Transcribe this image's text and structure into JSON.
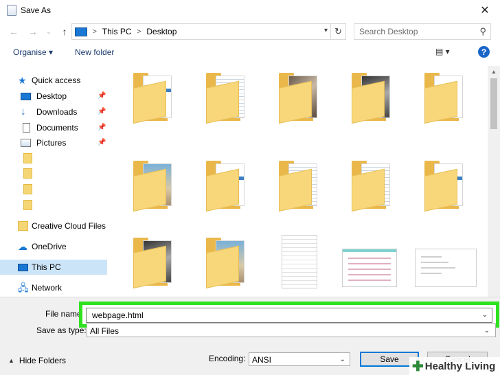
{
  "window": {
    "title": "Save As",
    "close_glyph": "✕"
  },
  "address": {
    "crumbs": [
      "This PC",
      "Desktop"
    ],
    "separator": ">",
    "search_placeholder": "Search Desktop"
  },
  "toolbar": {
    "organise": "Organise ▾",
    "new_folder": "New folder",
    "help": "?"
  },
  "sidebar": {
    "quick_access": "Quick access",
    "desktop": "Desktop",
    "downloads": "Downloads",
    "documents": "Documents",
    "pictures": "Pictures",
    "creative_cloud": "Creative Cloud Files",
    "onedrive": "OneDrive",
    "this_pc": "This PC",
    "network": "Network"
  },
  "form": {
    "file_name_label": "File name:",
    "file_name_value": "webpage.html",
    "save_as_type_label": "Save as type:",
    "save_as_type_value": "All Files",
    "hide_folders": "Hide Folders",
    "encoding_label": "Encoding:",
    "encoding_value": "ANSI",
    "save_button": "Save",
    "cancel_button": "Cancel"
  },
  "watermark": {
    "plus": "✚",
    "text": "Healthy Living"
  },
  "colors": {
    "highlight": "#2ee21f",
    "accent": "#0078d7",
    "folder": "#f7d77a"
  },
  "icons": {
    "back": "arrow-left-icon",
    "forward": "arrow-right-icon",
    "up": "arrow-up-icon",
    "refresh": "refresh-icon",
    "search": "search-icon",
    "help": "help-icon"
  }
}
